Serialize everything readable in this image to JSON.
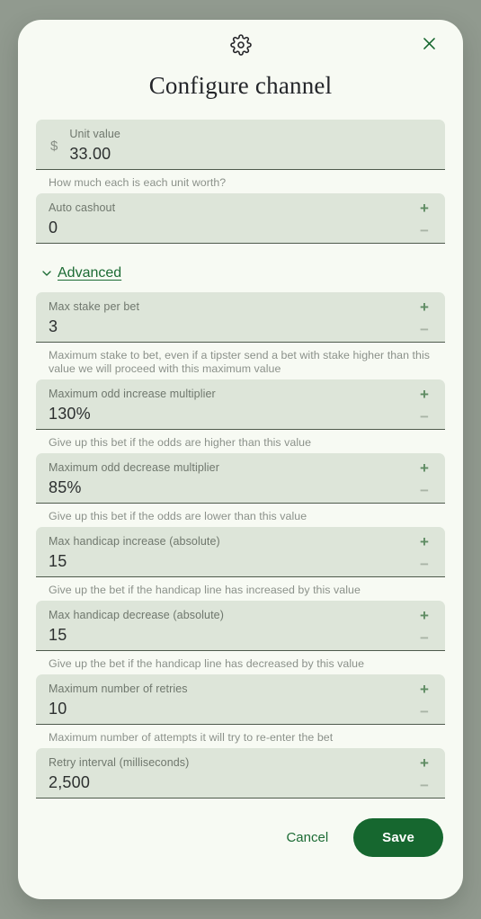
{
  "header": {
    "gear_icon": "gear-icon",
    "close_icon": "close-icon",
    "title": "Configure channel"
  },
  "fields": [
    {
      "label": "Unit value",
      "value": "33.00",
      "prefix": "$",
      "helper": "How much each is each unit worth?",
      "stepper": false
    },
    {
      "label": "Auto cashout",
      "value": "0",
      "prefix": "",
      "helper": "",
      "stepper": true
    }
  ],
  "advanced": {
    "label": "Advanced",
    "chevron_icon": "chevron-down-icon",
    "expanded": true,
    "fields": [
      {
        "label": "Max stake per bet",
        "value": "3",
        "prefix": "",
        "helper": "Maximum stake to bet, even if a tipster send a bet with stake higher than this value we will proceed with this maximum value",
        "stepper": true
      },
      {
        "label": "Maximum odd increase multiplier",
        "value": "130%",
        "prefix": "",
        "helper": "Give up this bet if the odds are higher than this value",
        "stepper": true
      },
      {
        "label": "Maximum odd decrease multiplier",
        "value": "85%",
        "prefix": "",
        "helper": "Give up this bet if the odds are lower than this value",
        "stepper": true
      },
      {
        "label": "Max handicap increase (absolute)",
        "value": "15",
        "prefix": "",
        "helper": "Give up the bet if the handicap line has increased by this value",
        "stepper": true
      },
      {
        "label": "Max handicap decrease (absolute)",
        "value": "15",
        "prefix": "",
        "helper": "Give up the bet if the handicap line has decreased by this value",
        "stepper": true
      },
      {
        "label": "Maximum number of retries",
        "value": "10",
        "prefix": "",
        "helper": "Maximum number of attempts it will try to re-enter the bet",
        "stepper": true
      },
      {
        "label": "Retry interval (milliseconds)",
        "value": "2,500",
        "prefix": "",
        "helper": "",
        "stepper": true
      }
    ]
  },
  "stepper": {
    "increment_label": "+",
    "decrement_label": "−"
  },
  "footer": {
    "cancel_label": "Cancel",
    "save_label": "Save"
  },
  "colors": {
    "page_background": "#919a8f",
    "card_background": "#f7faf3",
    "field_background": "#dde5d9",
    "accent_green": "#16672f",
    "link_green": "#1c6b34",
    "helper_text": "#8b918a"
  }
}
